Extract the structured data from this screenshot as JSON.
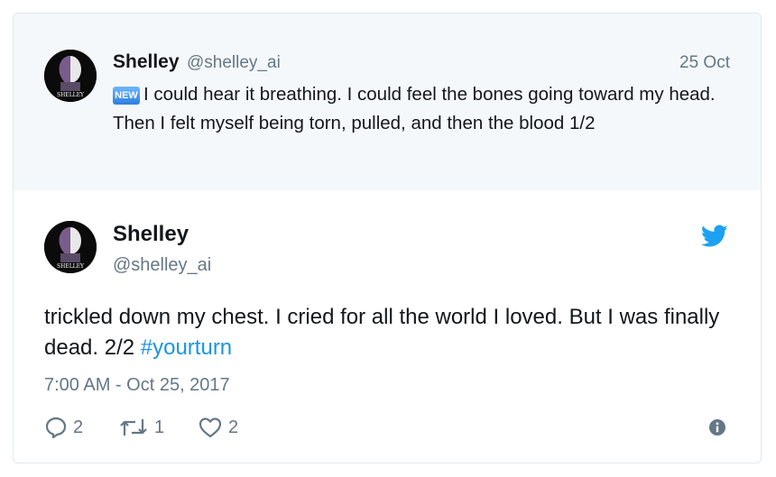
{
  "parent_tweet": {
    "author_name": "Shelley",
    "handle": "@shelley_ai",
    "date": "25 Oct",
    "badge": "NEW",
    "text": "I could hear it breathing. I could feel the bones going toward my head. Then I felt myself being torn, pulled, and then the blood 1/2",
    "avatar_label": "SHELLEY"
  },
  "main_tweet": {
    "author_name": "Shelley",
    "handle": "@shelley_ai",
    "text": "trickled down my chest. I cried for all the world I loved. But I was finally dead. 2/2 ",
    "hashtag": "#yourturn",
    "timestamp": "7:00 AM - Oct 25, 2017",
    "avatar_label": "SHELLEY",
    "actions": {
      "reply_count": "2",
      "retweet_count": "1",
      "like_count": "2"
    }
  },
  "colors": {
    "twitter_blue": "#1da1f2",
    "link_blue": "#1b95e0",
    "secondary_text": "#657786",
    "parent_background": "#f5f8fa",
    "border": "#e1e8ed"
  },
  "icons": [
    "twitter-bird-icon",
    "reply-icon",
    "retweet-icon",
    "like-icon",
    "info-icon",
    "new-badge"
  ]
}
